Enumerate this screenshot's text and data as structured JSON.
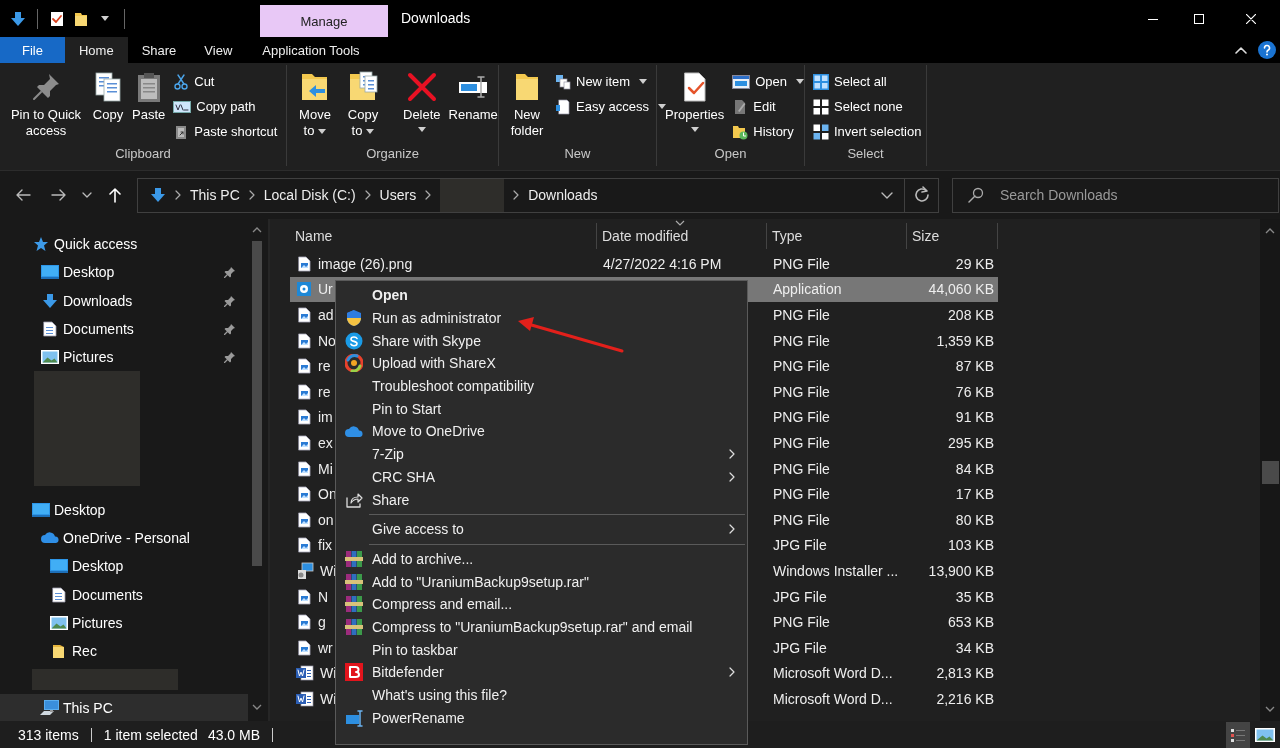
{
  "window": {
    "title": "Downloads",
    "context_tab": "Manage"
  },
  "ribbon_tabs": [
    {
      "label": "File",
      "kind": "file",
      "selected": false
    },
    {
      "label": "Home",
      "kind": "tab",
      "selected": true
    },
    {
      "label": "Share",
      "kind": "tab",
      "selected": false
    },
    {
      "label": "View",
      "kind": "tab",
      "selected": false
    },
    {
      "label": "Application Tools",
      "kind": "context",
      "selected": false
    }
  ],
  "ribbon_groups": [
    {
      "name": "Clipboard",
      "commands": [
        {
          "label": "Pin to Quick access",
          "kind": "large",
          "dropdown": false
        },
        {
          "label": "Copy",
          "kind": "large",
          "dropdown": false
        },
        {
          "label": "Paste",
          "kind": "large",
          "dropdown": false
        },
        {
          "label": "Cut",
          "kind": "small",
          "dropdown": false
        },
        {
          "label": "Copy path",
          "kind": "small",
          "dropdown": false
        },
        {
          "label": "Paste shortcut",
          "kind": "small",
          "dropdown": false
        }
      ]
    },
    {
      "name": "Organize",
      "commands": [
        {
          "label": "Move to",
          "kind": "large",
          "dropdown": true
        },
        {
          "label": "Copy to",
          "kind": "large",
          "dropdown": true
        },
        {
          "label": "Delete",
          "kind": "large",
          "dropdown": true
        },
        {
          "label": "Rename",
          "kind": "large",
          "dropdown": false
        }
      ]
    },
    {
      "name": "New",
      "commands": [
        {
          "label": "New folder",
          "kind": "large",
          "dropdown": false
        },
        {
          "label": "New item",
          "kind": "small",
          "dropdown": true
        },
        {
          "label": "Easy access",
          "kind": "small",
          "dropdown": true
        }
      ]
    },
    {
      "name": "Open",
      "commands": [
        {
          "label": "Properties",
          "kind": "large",
          "dropdown": true
        },
        {
          "label": "Open",
          "kind": "small",
          "dropdown": true
        },
        {
          "label": "Edit",
          "kind": "small",
          "dropdown": false
        },
        {
          "label": "History",
          "kind": "small",
          "dropdown": false
        }
      ]
    },
    {
      "name": "Select",
      "commands": [
        {
          "label": "Select all",
          "kind": "small",
          "dropdown": false
        },
        {
          "label": "Select none",
          "kind": "small",
          "dropdown": false
        },
        {
          "label": "Invert selection",
          "kind": "small",
          "dropdown": false
        }
      ]
    }
  ],
  "address_bar": {
    "breadcrumb": [
      {
        "kind": "folder",
        "label": "This PC"
      },
      {
        "kind": "folder",
        "label": "Local Disk (C:)"
      },
      {
        "kind": "folder",
        "label": "Users"
      },
      {
        "kind": "redacted"
      },
      {
        "kind": "folder",
        "label": "Downloads"
      }
    ]
  },
  "search": {
    "placeholder": "Search Downloads"
  },
  "navigation_pane": [
    {
      "kind": "item",
      "label": "Quick access",
      "hovered": false,
      "children": [
        {
          "kind": "item",
          "label": "Desktop",
          "pinned": true,
          "hovered": false
        },
        {
          "kind": "item",
          "label": "Downloads",
          "pinned": true,
          "hovered": false
        },
        {
          "kind": "item",
          "label": "Documents",
          "pinned": true,
          "hovered": false
        },
        {
          "kind": "item",
          "label": "Pictures",
          "pinned": true,
          "hovered": false
        },
        {
          "kind": "redacted-block"
        }
      ]
    },
    {
      "kind": "item",
      "label": "Desktop",
      "hovered": false,
      "children": [
        {
          "kind": "item",
          "label": "OneDrive - Personal",
          "hovered": false,
          "children": [
            {
              "kind": "item",
              "label": "Desktop",
              "hovered": false
            },
            {
              "kind": "item",
              "label": "Documents",
              "hovered": false
            },
            {
              "kind": "item",
              "label": "Pictures",
              "hovered": false
            },
            {
              "kind": "item",
              "label": "Rec",
              "hovered": false
            }
          ]
        },
        {
          "kind": "redacted-row"
        },
        {
          "kind": "item",
          "label": "This PC",
          "hovered": true
        }
      ]
    }
  ],
  "file_list": {
    "columns": [
      {
        "label": "Name",
        "sorted": false
      },
      {
        "label": "Date modified",
        "sorted": true
      },
      {
        "label": "Type",
        "sorted": false
      },
      {
        "label": "Size",
        "sorted": false
      }
    ],
    "rows": [
      {
        "name": "image (26).png",
        "date": "4/27/2022 4:16 PM",
        "type": "PNG File",
        "size": "29 KB",
        "kind": "image",
        "selected": false
      },
      {
        "name": "Ur",
        "type": "Application",
        "size": "44,060 KB",
        "kind": "application",
        "selected": true
      },
      {
        "name": "ad",
        "type": "PNG File",
        "size": "208 KB",
        "kind": "image",
        "selected": false
      },
      {
        "name": "No",
        "type": "PNG File",
        "size": "1,359 KB",
        "kind": "image",
        "selected": false
      },
      {
        "name": "re",
        "type": "PNG File",
        "size": "87 KB",
        "kind": "image",
        "selected": false
      },
      {
        "name": "re",
        "type": "PNG File",
        "size": "76 KB",
        "kind": "image",
        "selected": false
      },
      {
        "name": "im",
        "type": "PNG File",
        "size": "91 KB",
        "kind": "image",
        "selected": false
      },
      {
        "name": "ex",
        "type": "PNG File",
        "size": "295 KB",
        "kind": "image",
        "selected": false
      },
      {
        "name": "Mi",
        "type": "PNG File",
        "size": "84 KB",
        "kind": "image",
        "selected": false
      },
      {
        "name": "On",
        "type": "PNG File",
        "size": "17 KB",
        "kind": "image",
        "selected": false
      },
      {
        "name": "on",
        "type": "PNG File",
        "size": "80 KB",
        "kind": "image",
        "selected": false
      },
      {
        "name": "fix",
        "type": "JPG File",
        "size": "103 KB",
        "kind": "image",
        "selected": false
      },
      {
        "name": "Wi",
        "type": "Windows Installer ...",
        "size": "13,900 KB",
        "kind": "installer",
        "selected": false
      },
      {
        "name": "N",
        "type": "JPG File",
        "size": "35 KB",
        "kind": "image",
        "selected": false
      },
      {
        "name": "g",
        "type": "PNG File",
        "size": "653 KB",
        "kind": "image",
        "selected": false
      },
      {
        "name": "wr",
        "type": "JPG File",
        "size": "34 KB",
        "kind": "image",
        "selected": false
      },
      {
        "name": "Wi",
        "type": "Microsoft Word D...",
        "size": "2,813 KB",
        "kind": "document",
        "selected": false
      },
      {
        "name": "Wi",
        "type": "Microsoft Word D...",
        "size": "2,216 KB",
        "kind": "document",
        "selected": false
      }
    ]
  },
  "context_menu": {
    "items": [
      {
        "kind": "command",
        "label": "Open",
        "default": true,
        "submenu": false
      },
      {
        "kind": "command",
        "label": "Run as administrator",
        "default": false,
        "submenu": false
      },
      {
        "kind": "command",
        "label": "Share with Skype",
        "default": false,
        "submenu": false
      },
      {
        "kind": "command",
        "label": "Upload with ShareX",
        "default": false,
        "submenu": false
      },
      {
        "kind": "command",
        "label": "Troubleshoot compatibility",
        "default": false,
        "submenu": false
      },
      {
        "kind": "command",
        "label": "Pin to Start",
        "default": false,
        "submenu": false
      },
      {
        "kind": "command",
        "label": "Move to OneDrive",
        "default": false,
        "submenu": false
      },
      {
        "kind": "command",
        "label": "7-Zip",
        "default": false,
        "submenu": true
      },
      {
        "kind": "command",
        "label": "CRC SHA",
        "default": false,
        "submenu": true
      },
      {
        "kind": "command",
        "label": "Share",
        "default": false,
        "submenu": false
      },
      {
        "kind": "separator"
      },
      {
        "kind": "command",
        "label": "Give access to",
        "default": false,
        "submenu": true
      },
      {
        "kind": "separator"
      },
      {
        "kind": "command",
        "label": "Add to archive...",
        "default": false,
        "submenu": false
      },
      {
        "kind": "command",
        "label": "Add to \"UraniumBackup9setup.rar\"",
        "default": false,
        "submenu": false
      },
      {
        "kind": "command",
        "label": "Compress and email...",
        "default": false,
        "submenu": false
      },
      {
        "kind": "command",
        "label": "Compress to \"UraniumBackup9setup.rar\" and email",
        "default": false,
        "submenu": false
      },
      {
        "kind": "command",
        "label": "Pin to taskbar",
        "default": false,
        "submenu": false
      },
      {
        "kind": "command",
        "label": "Bitdefender",
        "default": false,
        "submenu": true
      },
      {
        "kind": "command",
        "label": "What's using this file?",
        "default": false,
        "submenu": false
      },
      {
        "kind": "command",
        "label": "PowerRename",
        "default": false,
        "submenu": false
      }
    ]
  },
  "annotations": [
    {
      "kind": "arrow"
    }
  ],
  "status_bar": {
    "item_count": "313 items",
    "selection": "1 item selected",
    "selection_size": "43.0 MB",
    "views": [
      {
        "selected": true
      },
      {
        "selected": false
      }
    ]
  }
}
